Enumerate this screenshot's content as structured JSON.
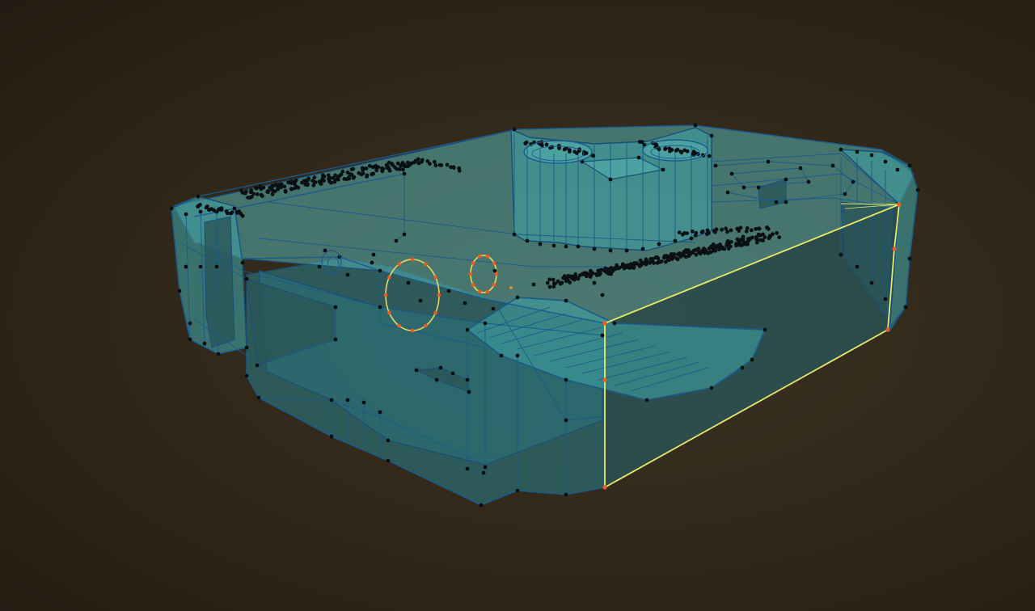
{
  "viewport": {
    "background": "#302719",
    "mode": "edit-mode-vertex-select"
  },
  "mesh": {
    "face_color": "#3f9ea0",
    "edge_color": "#1a5a8c",
    "vertex_color": "#0a0f12",
    "selected_vertex_color": "#f05a22",
    "selected_edge_color": "#e9e96a"
  }
}
